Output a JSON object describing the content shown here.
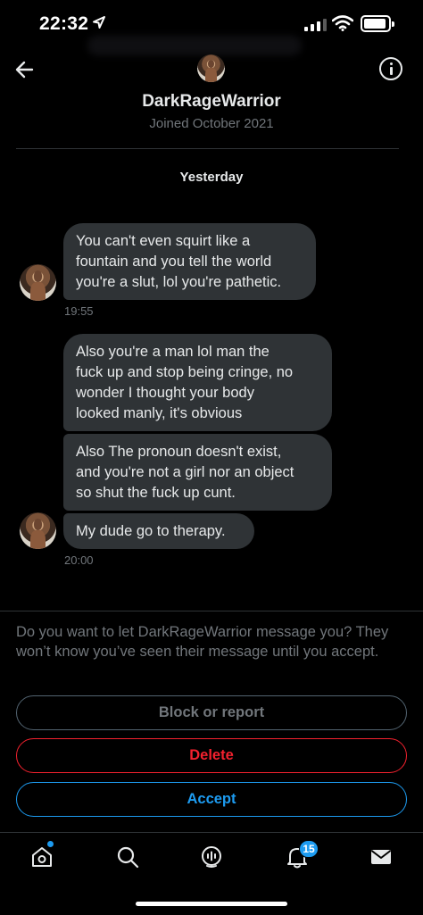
{
  "status_bar": {
    "time": "22:32"
  },
  "header": {
    "username": "DarkRageWarrior",
    "joined": "Joined October 2021"
  },
  "conversation": {
    "day_label": "Yesterday",
    "messages": [
      {
        "text": "You can't even squirt like a\nfountain and you tell the world\nyou're a slut, lol you're pathetic."
      },
      {
        "text": "Also you're a man lol man the\nfuck up and stop being cringe, no\nwonder I thought your body\nlooked manly, it's obvious"
      },
      {
        "text": "Also The pronoun doesn't exist,\nand you're not a girl nor an object\nso shut the fuck up cunt."
      },
      {
        "text": "My dude go to therapy."
      }
    ],
    "timestamps": [
      "19:55",
      "20:00"
    ]
  },
  "request": {
    "prompt": "Do you want to let DarkRageWarrior message you? They won’t know you’ve seen their message until you accept.",
    "block_label": "Block or report",
    "delete_label": "Delete",
    "accept_label": "Accept"
  },
  "nav": {
    "items": [
      "home-icon",
      "search-icon",
      "spaces-icon",
      "notifications-icon",
      "messages-icon"
    ],
    "notification_count": "15"
  },
  "colors": {
    "background": "#000000",
    "bubble": "#2f3336",
    "muted_text": "#71767b",
    "accent_blue": "#1d9bf0",
    "danger_red": "#f4212e"
  }
}
